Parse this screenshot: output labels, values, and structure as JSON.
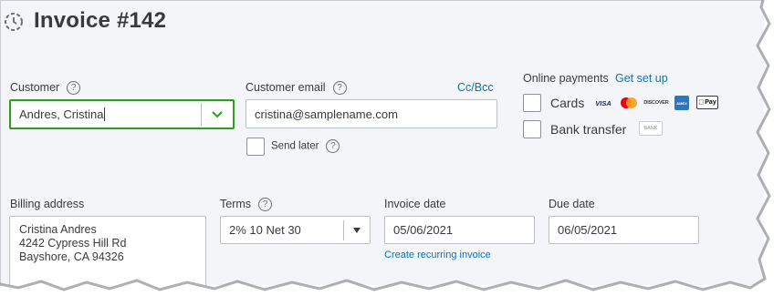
{
  "invoice": {
    "title": "Invoice #142"
  },
  "customer": {
    "label": "Customer",
    "help": "?",
    "value": "Andres, Cristina"
  },
  "customer_email": {
    "label": "Customer email",
    "help": "?",
    "value": "cristina@samplename.com",
    "cc_bcc": "Cc/Bcc"
  },
  "send_later": {
    "label": "Send later",
    "help": "?"
  },
  "online_payments": {
    "label": "Online payments",
    "get_set_up": "Get set up",
    "cards_label": "Cards",
    "bank_transfer_label": "Bank transfer",
    "card_logos": [
      "VISA",
      "mastercard",
      "DISCOVER",
      "AMEX",
      "Pay"
    ],
    "bank_logo": "BANK"
  },
  "billing_address": {
    "label": "Billing address",
    "line1": "Cristina Andres",
    "line2": "4242 Cypress Hill Rd",
    "line3": "Bayshore, CA  94326"
  },
  "terms": {
    "label": "Terms",
    "help": "?",
    "value": "2% 10 Net 30"
  },
  "invoice_date": {
    "label": "Invoice date",
    "value": "05/06/2021",
    "recurring_link": "Create recurring invoice"
  },
  "due_date": {
    "label": "Due date",
    "value": "06/05/2021"
  },
  "colors": {
    "accent_green": "#2ca01c",
    "link_blue": "#0077c5",
    "background": "#f4f5f8"
  }
}
